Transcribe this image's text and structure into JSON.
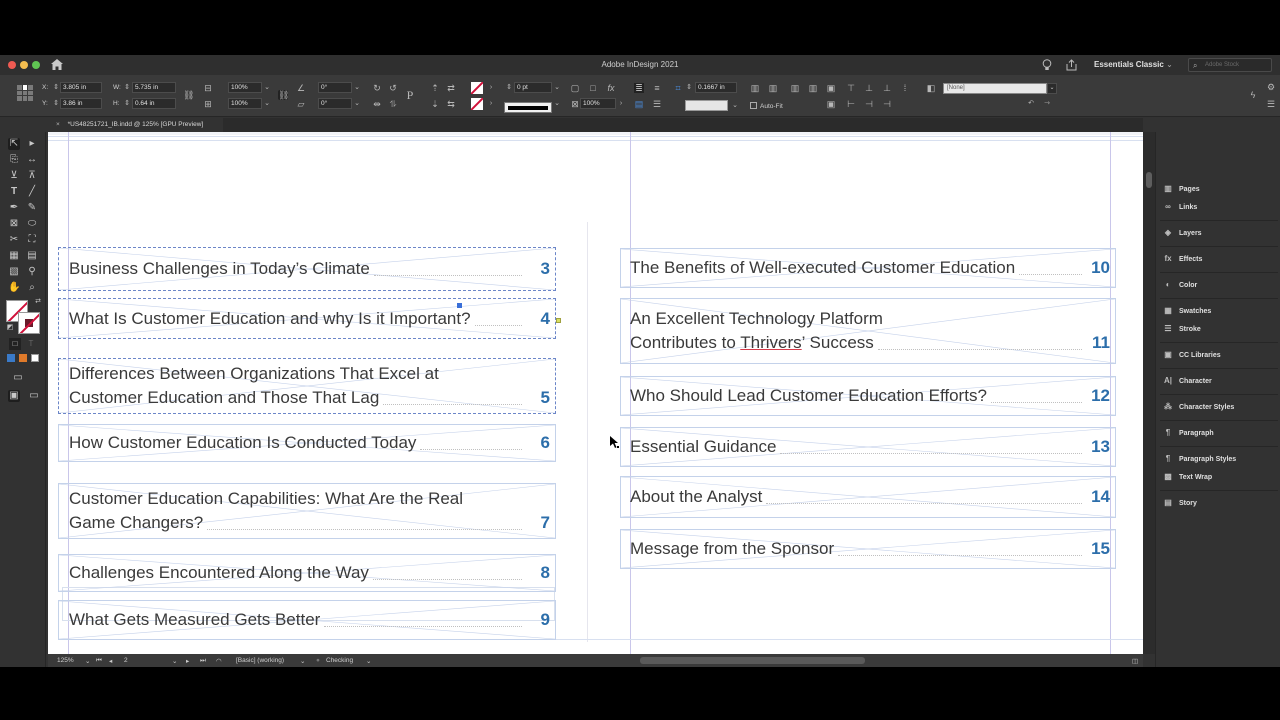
{
  "window": {
    "app_title": "Adobe InDesign 2021",
    "workspace": "Essentials Classic",
    "search_placeholder": "Adobe Stock"
  },
  "control_bar": {
    "x_label": "X:",
    "x_value": "3.805 in",
    "y_label": "Y:",
    "y_value": "3.86 in",
    "w_label": "W:",
    "w_value": "5.735 in",
    "h_label": "H:",
    "h_value": "0.64 in",
    "scale_x": "100%",
    "scale_y": "100%",
    "rotate": "0°",
    "shear": "0°",
    "stroke_weight": "0 pt",
    "opacity": "100%",
    "inset": "0.1667 in",
    "auto_fit_label": "Auto-Fit",
    "object_style": "[None]"
  },
  "document_tab": {
    "title": "*US48251721_IB.indd @ 125% [GPU Preview]"
  },
  "toc": {
    "left_column": [
      {
        "lines": [
          "Business Challenges in Today’s Climate"
        ],
        "page": "3",
        "selected": true
      },
      {
        "lines": [
          "What Is Customer Education and why Is it Important?"
        ],
        "page": "4",
        "selected": true
      },
      {
        "lines": [
          "Differences Between Organizations That Excel at",
          "Customer Education and Those That Lag"
        ],
        "page": "5",
        "selected": true
      },
      {
        "lines": [
          "How Customer Education Is Conducted Today"
        ],
        "page": "6",
        "selected": false
      },
      {
        "lines": [
          "Customer Education Capabilities: What Are the Real",
          "Game Changers?"
        ],
        "page": "7",
        "selected": false
      },
      {
        "lines": [
          "Challenges Encountered Along the Way"
        ],
        "page": "8",
        "selected": false
      },
      {
        "lines": [
          "What Gets Measured Gets Better"
        ],
        "page": "9",
        "selected": false
      }
    ],
    "right_column": [
      {
        "lines": [
          "The Benefits of Well-executed Customer Education"
        ],
        "page": "10"
      },
      {
        "lines": [
          "An Excellent Technology Platform",
          "Contributes to Thrivers’ Success"
        ],
        "page": "11",
        "spellcheck_word": "Thrivers"
      },
      {
        "lines": [
          "Who Should Lead Customer Education Efforts?"
        ],
        "page": "12"
      },
      {
        "lines": [
          "Essential Guidance"
        ],
        "page": "13"
      },
      {
        "lines": [
          "About the Analyst"
        ],
        "page": "14"
      },
      {
        "lines": [
          "Message from the Sponsor"
        ],
        "page": "15"
      }
    ],
    "page_number_color": "#2c6eaa",
    "text_color": "#3a3a3a"
  },
  "panels": [
    {
      "label": "Pages",
      "icon": "pages-icon"
    },
    {
      "label": "Links",
      "icon": "links-icon"
    },
    {
      "label": "Layers",
      "icon": "layers-icon"
    },
    {
      "label": "Effects",
      "icon": "fx-icon"
    },
    {
      "label": "Color",
      "icon": "color-icon"
    },
    {
      "label": "Swatches",
      "icon": "swatches-icon"
    },
    {
      "label": "Stroke",
      "icon": "stroke-icon"
    },
    {
      "label": "CC Libraries",
      "icon": "cc-libraries-icon"
    },
    {
      "label": "Character",
      "icon": "character-icon"
    },
    {
      "label": "Character Styles",
      "icon": "character-styles-icon"
    },
    {
      "label": "Paragraph",
      "icon": "paragraph-icon"
    },
    {
      "label": "Paragraph Styles",
      "icon": "paragraph-styles-icon"
    },
    {
      "label": "Text Wrap",
      "icon": "text-wrap-icon"
    },
    {
      "label": "Story",
      "icon": "story-icon"
    }
  ],
  "status_bar": {
    "zoom": "125%",
    "page": "2",
    "preflight_profile": "[Basic] (working)",
    "preflight_status": "Checking"
  }
}
